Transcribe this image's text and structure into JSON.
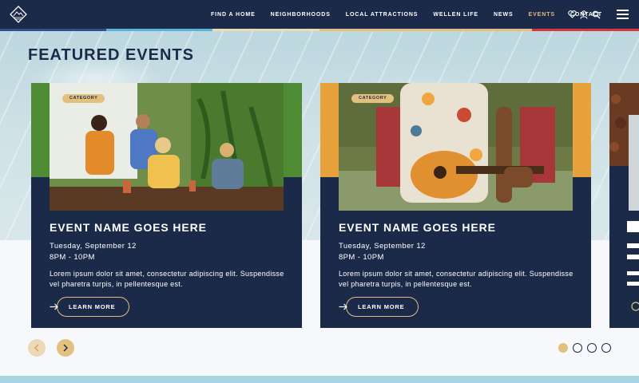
{
  "nav": {
    "logo_icon": "diamond-mountain-logo",
    "items": [
      {
        "label": "FIND A HOME",
        "active": false
      },
      {
        "label": "NEIGHBORHOODS",
        "active": false
      },
      {
        "label": "LOCAL ATTRACTIONS",
        "active": false
      },
      {
        "label": "WELLEN LIFE",
        "active": false
      },
      {
        "label": "NEWS",
        "active": false
      },
      {
        "label": "EVENTS",
        "active": true
      },
      {
        "label": "CONTACT",
        "active": false
      }
    ],
    "icons": [
      "heart-icon",
      "user-icon",
      "search-icon",
      "hamburger-menu-icon"
    ],
    "accent_colors": [
      "#2f4f8f",
      "#5ab4d6",
      "#ecd9b5",
      "#e2c07e",
      "#d8353c"
    ]
  },
  "section": {
    "heading": "FEATURED EVENTS"
  },
  "cards": [
    {
      "badge": "CATEGORY",
      "title": "EVENT NAME GOES HERE",
      "date": "Tuesday, September 12",
      "time": "8PM - 10PM",
      "description": "Lorem ipsum dolor sit amet, consectetur adipiscing elit. Suspendisse vel pharetra turpis, in pellentesque est.",
      "button": "LEARN MORE"
    },
    {
      "badge": "CATEGORY",
      "title": "EVENT NAME GOES HERE",
      "date": "Tuesday, September 12",
      "time": "8PM - 10PM",
      "description": "Lorem ipsum dolor sit amet, consectetur adipiscing elit. Suspendisse vel pharetra turpis, in pellentesque est.",
      "button": "LEARN MORE"
    }
  ],
  "carousel": {
    "prev_icon": "chevron-left-icon",
    "next_icon": "chevron-right-icon",
    "dots": [
      true,
      false,
      false,
      false
    ]
  },
  "colors": {
    "navy": "#1c2a4a",
    "gold": "#e2c07e",
    "water": "#cfe2e6"
  }
}
